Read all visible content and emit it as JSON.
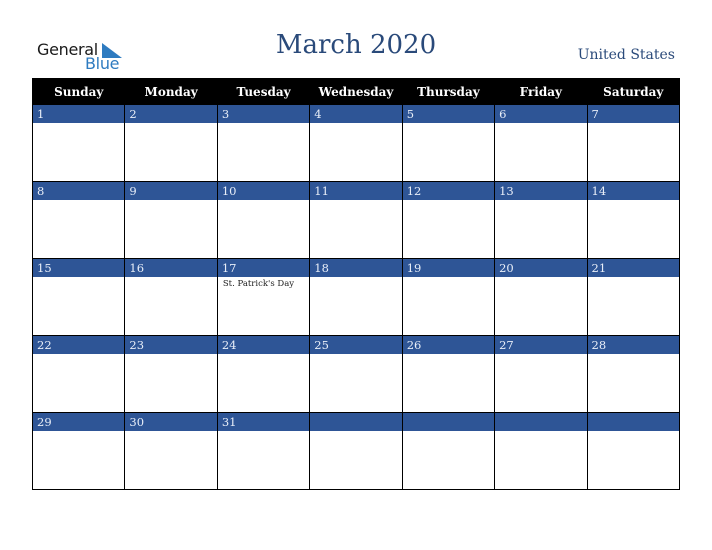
{
  "brand": {
    "line1": "General",
    "line2": "Blue",
    "accent": "#2e7bc0"
  },
  "header": {
    "title": "March 2020",
    "country": "United States"
  },
  "weekdays": [
    "Sunday",
    "Monday",
    "Tuesday",
    "Wednesday",
    "Thursday",
    "Friday",
    "Saturday"
  ],
  "colors": {
    "day_bar": "#2e5596",
    "header_bg": "#000000",
    "title": "#2a4a7a"
  },
  "weeks": [
    [
      {
        "day": "1",
        "event": ""
      },
      {
        "day": "2",
        "event": ""
      },
      {
        "day": "3",
        "event": ""
      },
      {
        "day": "4",
        "event": ""
      },
      {
        "day": "5",
        "event": ""
      },
      {
        "day": "6",
        "event": ""
      },
      {
        "day": "7",
        "event": ""
      }
    ],
    [
      {
        "day": "8",
        "event": ""
      },
      {
        "day": "9",
        "event": ""
      },
      {
        "day": "10",
        "event": ""
      },
      {
        "day": "11",
        "event": ""
      },
      {
        "day": "12",
        "event": ""
      },
      {
        "day": "13",
        "event": ""
      },
      {
        "day": "14",
        "event": ""
      }
    ],
    [
      {
        "day": "15",
        "event": ""
      },
      {
        "day": "16",
        "event": ""
      },
      {
        "day": "17",
        "event": "St. Patrick's Day"
      },
      {
        "day": "18",
        "event": ""
      },
      {
        "day": "19",
        "event": ""
      },
      {
        "day": "20",
        "event": ""
      },
      {
        "day": "21",
        "event": ""
      }
    ],
    [
      {
        "day": "22",
        "event": ""
      },
      {
        "day": "23",
        "event": ""
      },
      {
        "day": "24",
        "event": ""
      },
      {
        "day": "25",
        "event": ""
      },
      {
        "day": "26",
        "event": ""
      },
      {
        "day": "27",
        "event": ""
      },
      {
        "day": "28",
        "event": ""
      }
    ],
    [
      {
        "day": "29",
        "event": ""
      },
      {
        "day": "30",
        "event": ""
      },
      {
        "day": "31",
        "event": ""
      },
      {
        "day": "",
        "event": ""
      },
      {
        "day": "",
        "event": ""
      },
      {
        "day": "",
        "event": ""
      },
      {
        "day": "",
        "event": ""
      }
    ]
  ]
}
